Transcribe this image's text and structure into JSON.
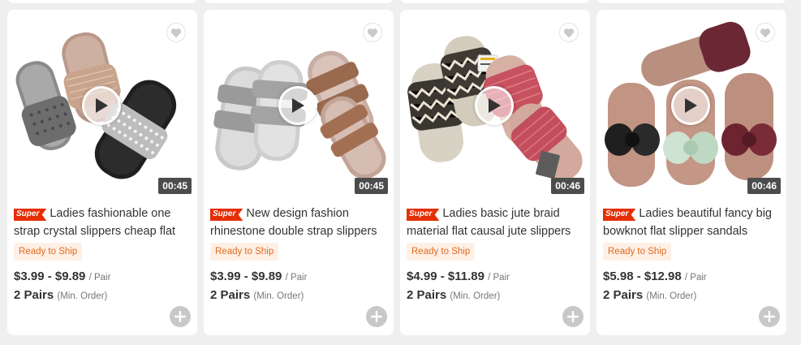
{
  "accent": {
    "super_red": "#e62e04",
    "ready_orange": "#e06a1e"
  },
  "products": [
    {
      "badge": "Super",
      "title": "Ladies fashionable one strap crystal slippers cheap flat",
      "duration": "00:45",
      "ready": "Ready to Ship",
      "price": "$3.99 - $9.89",
      "unit": "/ Pair",
      "moq": "2 Pairs",
      "moq_note": "(Min. Order)"
    },
    {
      "badge": "Super",
      "title": "New design fashion rhinestone double strap slippers",
      "duration": "00:45",
      "ready": "Ready to Ship",
      "price": "$3.99 - $9.89",
      "unit": "/ Pair",
      "moq": "2 Pairs",
      "moq_note": "(Min. Order)"
    },
    {
      "badge": "Super",
      "title": "Ladies basic jute braid material flat causal jute slippers",
      "duration": "00:46",
      "ready": "Ready to Ship",
      "price": "$4.99 - $11.89",
      "unit": "/ Pair",
      "moq": "2 Pairs",
      "moq_note": "(Min. Order)"
    },
    {
      "badge": "Super",
      "title": "Ladies beautiful fancy big bowknot flat slipper sandals",
      "duration": "00:46",
      "ready": "Ready to Ship",
      "price": "$5.98 - $12.98",
      "unit": "/ Pair",
      "moq": "2 Pairs",
      "moq_note": "(Min. Order)"
    }
  ],
  "icons": {
    "favorite": "heart-icon",
    "play": "play-icon",
    "add": "plus-icon"
  }
}
